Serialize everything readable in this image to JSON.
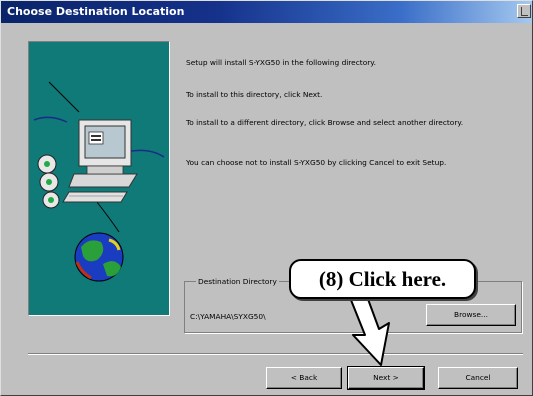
{
  "window": {
    "title": "Choose Destination Location"
  },
  "body_text": {
    "p1": "Setup will install S-YXG50 in the following directory.",
    "p2": "To install to this directory, click Next.",
    "p3": "To install to a different directory, click Browse and select another directory.",
    "p4": "You can choose not to install S-YXG50 by clicking Cancel to exit Setup."
  },
  "destination": {
    "group_label": "Destination Directory",
    "path": "C:\\YAMAHA\\SYXG50\\"
  },
  "buttons": {
    "browse": "Browse...",
    "back": "< Back",
    "next": "Next >",
    "cancel": "Cancel"
  },
  "annotation": {
    "callout": "(8)  Click here."
  },
  "colors": {
    "titlebar_start": "#0a246a",
    "titlebar_end": "#a6caf0",
    "dialog_face": "#c0c0c0",
    "illustration_bg": "#0f7a78"
  },
  "icons": [
    "computer-icon",
    "cd-discs-icon",
    "globe-icon",
    "arrow-pointer-icon"
  ]
}
